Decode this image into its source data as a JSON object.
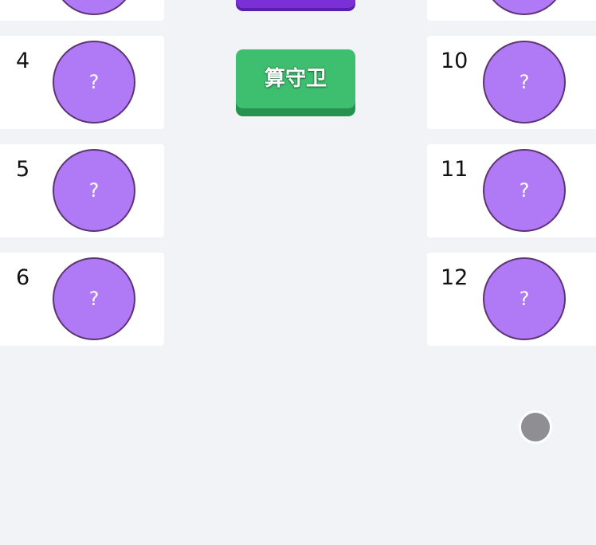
{
  "players_left": [
    {
      "number": "",
      "avatar": ""
    },
    {
      "number": "4",
      "avatar": "?"
    },
    {
      "number": "5",
      "avatar": "?"
    },
    {
      "number": "6",
      "avatar": "?"
    }
  ],
  "players_right": [
    {
      "number": "",
      "avatar": ""
    },
    {
      "number": "10",
      "avatar": "?"
    },
    {
      "number": "11",
      "avatar": "?"
    },
    {
      "number": "12",
      "avatar": "?"
    }
  ],
  "buttons": {
    "top_label": "",
    "guard_label": "算守卫"
  },
  "colors": {
    "background": "#f2f3f7",
    "avatar_fill": "#b07af7",
    "avatar_border": "#5e3470",
    "guard_button": "#3dbf6f",
    "top_button": "#7b2fd6",
    "floating_button": "#8e8e93"
  }
}
